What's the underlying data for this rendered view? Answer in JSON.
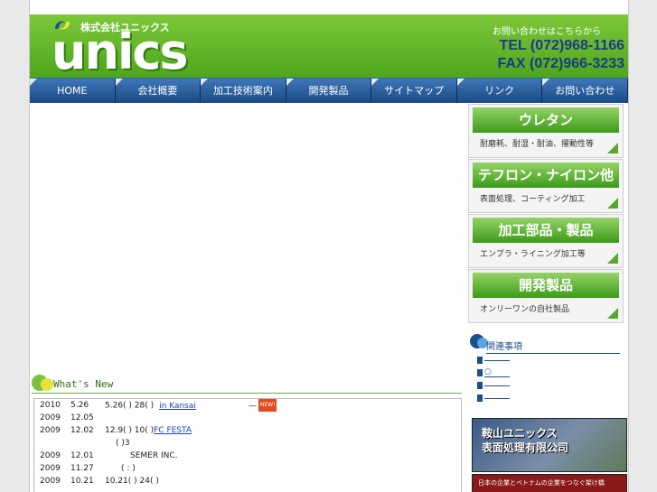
{
  "header": {
    "company_name": "株式会社ユニックス",
    "logo_word": "unics",
    "contact_label": "お問い合わせはこちらから",
    "tel": "TEL (072)968-1166",
    "fax": "FAX (072)966-3233"
  },
  "nav": {
    "items": [
      "HOME",
      "会社概要",
      "加工技術案内",
      "開発製品",
      "サイトマップ",
      "リンク",
      "お問い合わせ"
    ]
  },
  "whats_new": {
    "title": "What's New",
    "rows": [
      {
        "year": "2010",
        "date": "5.26",
        "text": "5.26( ) 28( )",
        "link": "in Kansai",
        "badge": "NEW!"
      },
      {
        "year": "2009",
        "date": "12.05",
        "text": "",
        "link": "",
        "badge": ""
      },
      {
        "year": "2009",
        "date": "12.02",
        "text": "12.9( ) 10( )",
        "link": "FC FESTA",
        "badge": "",
        "text2": "(        )3"
      },
      {
        "year": "2009",
        "date": "12.01",
        "text": "SEMER INC.",
        "link": "",
        "badge": ""
      },
      {
        "year": "2009",
        "date": "11.27",
        "text": "(   :        )",
        "link": "",
        "badge": ""
      },
      {
        "year": "2009",
        "date": "10.21",
        "text": "10.21( ) 24( )",
        "link": "",
        "badge": ""
      }
    ]
  },
  "sidebar": {
    "products": [
      {
        "title": "ウレタン",
        "sub": "耐磨耗、耐湿・耐油、擢動性等"
      },
      {
        "title": "テフロン・ナイロン他",
        "sub": "表面処理、コーティング加工"
      },
      {
        "title": "加工部品・製品",
        "sub": "エンプラ・ライニング加工等"
      },
      {
        "title": "開発製品",
        "sub": "オンリーワンの自社製品"
      }
    ],
    "related_title": "関連事項",
    "related_items": [
      "",
      "○",
      "",
      ""
    ],
    "banner1_text": "鞍山ユニックス\n表面処理有限公司",
    "banner2_text": "日本の企業とベトナムの企業をつなぐ架け橋"
  }
}
